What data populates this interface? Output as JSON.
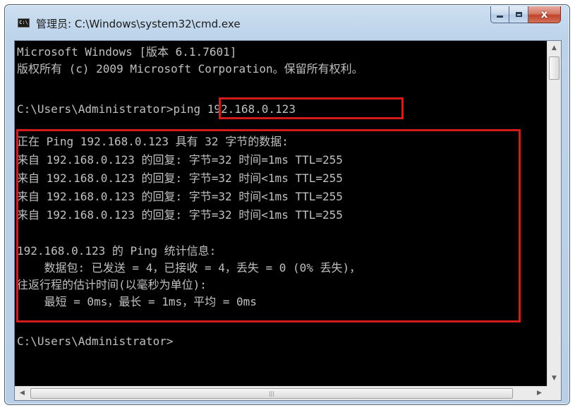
{
  "window": {
    "icon_text": "C:\\",
    "title": "管理员: C:\\Windows\\system32\\cmd.exe",
    "min_glyph": "",
    "max_glyph": "",
    "close_glyph": "x"
  },
  "console": {
    "lines": [
      "Microsoft Windows [版本 6.1.7601]",
      "版权所有 (c) 2009 Microsoft Corporation。保留所有权利。",
      "",
      "C:\\Users\\Administrator>ping 192.168.0.123",
      "",
      "正在 Ping 192.168.0.123 具有 32 字节的数据:",
      "来自 192.168.0.123 的回复: 字节=32 时间=1ms TTL=255",
      "来自 192.168.0.123 的回复: 字节=32 时间<1ms TTL=255",
      "来自 192.168.0.123 的回复: 字节=32 时间<1ms TTL=255",
      "来自 192.168.0.123 的回复: 字节=32 时间<1ms TTL=255",
      "",
      "192.168.0.123 的 Ping 统计信息:",
      "    数据包: 已发送 = 4，已接收 = 4，丢失 = 0 (0% 丢失)，",
      "往返行程的估计时间(以毫秒为单位):",
      "    最短 = 0ms，最长 = 1ms，平均 = 0ms",
      "",
      "C:\\Users\\Administrator>"
    ]
  },
  "scrollbars": {
    "up_arrow": "▲",
    "down_arrow": "▼",
    "left_arrow": "◀",
    "right_arrow": "▶",
    "h_thumb_grip": "|||"
  },
  "colors": {
    "console_bg": "#000000",
    "console_fg": "#c0c0c0",
    "highlight": "#d41c1c"
  }
}
